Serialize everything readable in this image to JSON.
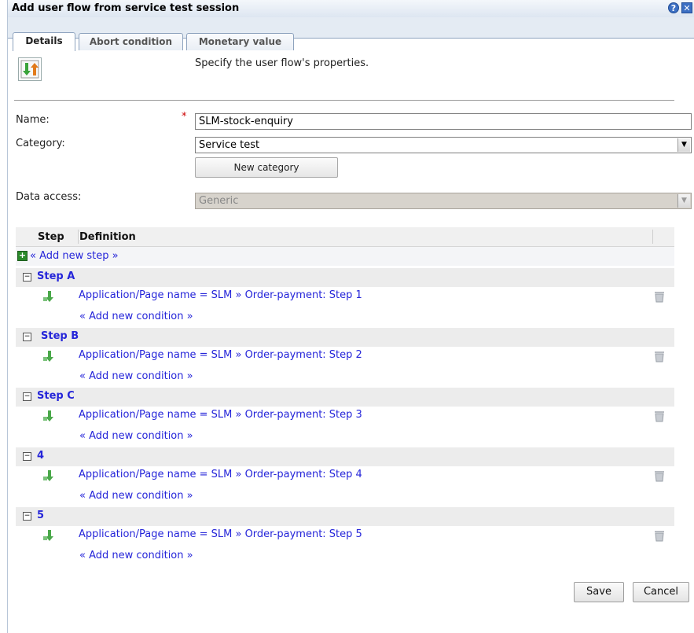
{
  "window": {
    "title": "Add user flow from service test session"
  },
  "tabs": [
    {
      "label": "Details"
    },
    {
      "label": "Abort condition"
    },
    {
      "label": "Monetary value"
    }
  ],
  "intro_text": "Specify the user flow's properties.",
  "form": {
    "name_label": "Name:",
    "required_mark": "*",
    "name_value": "SLM-stock-enquiry",
    "category_label": "Category:",
    "category_value": "Service test",
    "new_category_label": "New category",
    "data_access_label": "Data access:",
    "data_access_value": "Generic"
  },
  "grid": {
    "col_step": "Step",
    "col_definition": "Definition",
    "add_step_label": "« Add new step »",
    "add_condition_label": "« Add new condition »",
    "groups": [
      {
        "toggle": "⊟",
        "name": "Step A",
        "condition": "Application/Page name = SLM » Order-payment: Step 1"
      },
      {
        "toggle": "⊟",
        "name": "Step B",
        "condition": "Application/Page name = SLM » Order-payment: Step 2"
      },
      {
        "toggle": "⊟",
        "name": "Step C",
        "condition": "Application/Page name = SLM » Order-payment: Step 3"
      },
      {
        "toggle": "⊟",
        "name": "4",
        "condition": "Application/Page name = SLM » Order-payment: Step 4"
      },
      {
        "toggle": "⊟",
        "name": "5",
        "condition": "Application/Page name = SLM » Order-payment: Step 5"
      }
    ]
  },
  "footer": {
    "save_label": "Save",
    "cancel_label": "Cancel"
  },
  "icons": {
    "help": "help-icon",
    "close": "close-icon",
    "add": "plus-icon",
    "condition": "green-arrow-icon",
    "delete": "trash-icon"
  },
  "colors": {
    "link": "#2525d9",
    "accent": "#3c6fc3",
    "required": "#cc0000"
  }
}
